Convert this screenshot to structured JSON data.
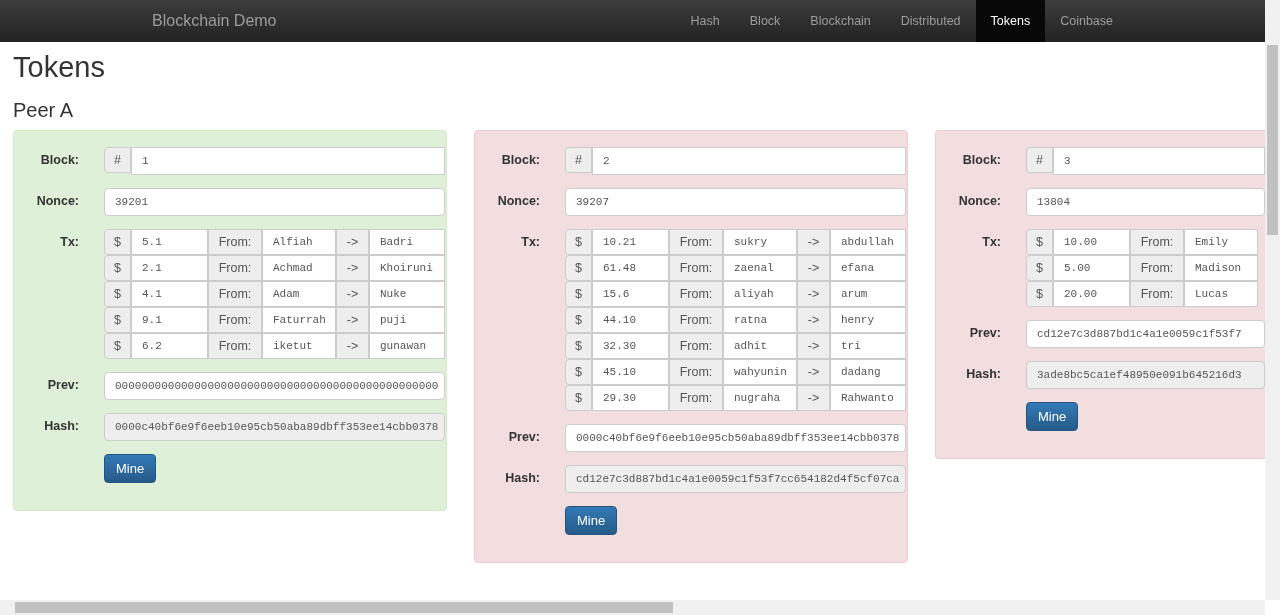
{
  "navbar": {
    "brand": "Blockchain Demo",
    "items": [
      {
        "label": "Hash",
        "selected": false
      },
      {
        "label": "Block",
        "selected": false
      },
      {
        "label": "Blockchain",
        "selected": false
      },
      {
        "label": "Distributed",
        "selected": false
      },
      {
        "label": "Tokens",
        "selected": true
      },
      {
        "label": "Coinbase",
        "selected": false
      }
    ]
  },
  "title": "Tokens",
  "peer": {
    "name": "Peer A",
    "blocks": [
      {
        "valid": true,
        "block_label": "Block:",
        "hash_sign": "#",
        "number": "1",
        "nonce_label": "Nonce:",
        "nonce": "39201",
        "tx_label": "Tx:",
        "txs": [
          {
            "currency": "$",
            "amount": "5.1",
            "from_label": "From:",
            "from": "Alfiah",
            "arrow": "->",
            "to": "Badri"
          },
          {
            "currency": "$",
            "amount": "2.1",
            "from_label": "From:",
            "from": "Achmad",
            "arrow": "->",
            "to": "Khoiruni"
          },
          {
            "currency": "$",
            "amount": "4.1",
            "from_label": "From:",
            "from": "Adam",
            "arrow": "->",
            "to": "Nuke"
          },
          {
            "currency": "$",
            "amount": "9.1",
            "from_label": "From:",
            "from": "Faturrah",
            "arrow": "->",
            "to": "puji"
          },
          {
            "currency": "$",
            "amount": "6.2",
            "from_label": "From:",
            "from": "iketut",
            "arrow": "->",
            "to": "gunawan"
          }
        ],
        "prev_label": "Prev:",
        "prev": "0000000000000000000000000000000000000000000000000",
        "hash_label": "Hash:",
        "hash": "0000c40bf6e9f6eeb10e95cb50aba89dbff353ee14cbb0378",
        "button": "Mine"
      },
      {
        "valid": false,
        "block_label": "Block:",
        "hash_sign": "#",
        "number": "2",
        "nonce_label": "Nonce:",
        "nonce": "39207",
        "tx_label": "Tx:",
        "txs": [
          {
            "currency": "$",
            "amount": "10.21",
            "from_label": "From:",
            "from": "sukry",
            "arrow": "->",
            "to": "abdullah"
          },
          {
            "currency": "$",
            "amount": "61.48",
            "from_label": "From:",
            "from": "zaenal",
            "arrow": "->",
            "to": "efana"
          },
          {
            "currency": "$",
            "amount": "15.6",
            "from_label": "From:",
            "from": "aliyah",
            "arrow": "->",
            "to": "arum"
          },
          {
            "currency": "$",
            "amount": "44.10",
            "from_label": "From:",
            "from": "ratna",
            "arrow": "->",
            "to": "henry"
          },
          {
            "currency": "$",
            "amount": "32.30",
            "from_label": "From:",
            "from": "adhit",
            "arrow": "->",
            "to": "tri"
          },
          {
            "currency": "$",
            "amount": "45.10",
            "from_label": "From:",
            "from": "wahyunin",
            "arrow": "->",
            "to": "dadang"
          },
          {
            "currency": "$",
            "amount": "29.30",
            "from_label": "From:",
            "from": "nugraha",
            "arrow": "->",
            "to": "Rahwanto"
          }
        ],
        "prev_label": "Prev:",
        "prev": "0000c40bf6e9f6eeb10e95cb50aba89dbff353ee14cbb0378",
        "hash_label": "Hash:",
        "hash": "cd12e7c3d887bd1c4a1e0059c1f53f7cc654182d4f5cf07ca",
        "button": "Mine"
      },
      {
        "valid": false,
        "block_label": "Block:",
        "hash_sign": "#",
        "number": "3",
        "nonce_label": "Nonce:",
        "nonce": "13804",
        "tx_label": "Tx:",
        "txs": [
          {
            "currency": "$",
            "amount": "10.00",
            "from_label": "From:",
            "from": "Emily"
          },
          {
            "currency": "$",
            "amount": "5.00",
            "from_label": "From:",
            "from": "Madison"
          },
          {
            "currency": "$",
            "amount": "20.00",
            "from_label": "From:",
            "from": "Lucas"
          }
        ],
        "prev_label": "Prev:",
        "prev": "cd12e7c3d887bd1c4a1e0059c1f53f7",
        "hash_label": "Hash:",
        "hash": "3ade8bc5ca1ef48950e091b645216d3",
        "button": "Mine"
      }
    ]
  }
}
